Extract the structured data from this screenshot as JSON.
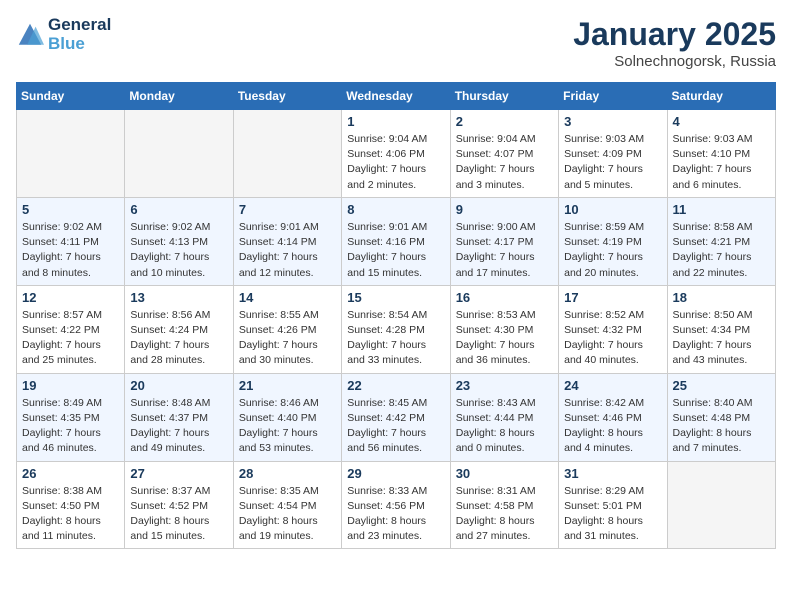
{
  "logo": {
    "line1": "General",
    "line2": "Blue"
  },
  "title": "January 2025",
  "subtitle": "Solnechnogorsk, Russia",
  "weekdays": [
    "Sunday",
    "Monday",
    "Tuesday",
    "Wednesday",
    "Thursday",
    "Friday",
    "Saturday"
  ],
  "weeks": [
    [
      {
        "day": "",
        "sunrise": "",
        "sunset": "",
        "daylight": ""
      },
      {
        "day": "",
        "sunrise": "",
        "sunset": "",
        "daylight": ""
      },
      {
        "day": "",
        "sunrise": "",
        "sunset": "",
        "daylight": ""
      },
      {
        "day": "1",
        "sunrise": "Sunrise: 9:04 AM",
        "sunset": "Sunset: 4:06 PM",
        "daylight": "Daylight: 7 hours and 2 minutes."
      },
      {
        "day": "2",
        "sunrise": "Sunrise: 9:04 AM",
        "sunset": "Sunset: 4:07 PM",
        "daylight": "Daylight: 7 hours and 3 minutes."
      },
      {
        "day": "3",
        "sunrise": "Sunrise: 9:03 AM",
        "sunset": "Sunset: 4:09 PM",
        "daylight": "Daylight: 7 hours and 5 minutes."
      },
      {
        "day": "4",
        "sunrise": "Sunrise: 9:03 AM",
        "sunset": "Sunset: 4:10 PM",
        "daylight": "Daylight: 7 hours and 6 minutes."
      }
    ],
    [
      {
        "day": "5",
        "sunrise": "Sunrise: 9:02 AM",
        "sunset": "Sunset: 4:11 PM",
        "daylight": "Daylight: 7 hours and 8 minutes."
      },
      {
        "day": "6",
        "sunrise": "Sunrise: 9:02 AM",
        "sunset": "Sunset: 4:13 PM",
        "daylight": "Daylight: 7 hours and 10 minutes."
      },
      {
        "day": "7",
        "sunrise": "Sunrise: 9:01 AM",
        "sunset": "Sunset: 4:14 PM",
        "daylight": "Daylight: 7 hours and 12 minutes."
      },
      {
        "day": "8",
        "sunrise": "Sunrise: 9:01 AM",
        "sunset": "Sunset: 4:16 PM",
        "daylight": "Daylight: 7 hours and 15 minutes."
      },
      {
        "day": "9",
        "sunrise": "Sunrise: 9:00 AM",
        "sunset": "Sunset: 4:17 PM",
        "daylight": "Daylight: 7 hours and 17 minutes."
      },
      {
        "day": "10",
        "sunrise": "Sunrise: 8:59 AM",
        "sunset": "Sunset: 4:19 PM",
        "daylight": "Daylight: 7 hours and 20 minutes."
      },
      {
        "day": "11",
        "sunrise": "Sunrise: 8:58 AM",
        "sunset": "Sunset: 4:21 PM",
        "daylight": "Daylight: 7 hours and 22 minutes."
      }
    ],
    [
      {
        "day": "12",
        "sunrise": "Sunrise: 8:57 AM",
        "sunset": "Sunset: 4:22 PM",
        "daylight": "Daylight: 7 hours and 25 minutes."
      },
      {
        "day": "13",
        "sunrise": "Sunrise: 8:56 AM",
        "sunset": "Sunset: 4:24 PM",
        "daylight": "Daylight: 7 hours and 28 minutes."
      },
      {
        "day": "14",
        "sunrise": "Sunrise: 8:55 AM",
        "sunset": "Sunset: 4:26 PM",
        "daylight": "Daylight: 7 hours and 30 minutes."
      },
      {
        "day": "15",
        "sunrise": "Sunrise: 8:54 AM",
        "sunset": "Sunset: 4:28 PM",
        "daylight": "Daylight: 7 hours and 33 minutes."
      },
      {
        "day": "16",
        "sunrise": "Sunrise: 8:53 AM",
        "sunset": "Sunset: 4:30 PM",
        "daylight": "Daylight: 7 hours and 36 minutes."
      },
      {
        "day": "17",
        "sunrise": "Sunrise: 8:52 AM",
        "sunset": "Sunset: 4:32 PM",
        "daylight": "Daylight: 7 hours and 40 minutes."
      },
      {
        "day": "18",
        "sunrise": "Sunrise: 8:50 AM",
        "sunset": "Sunset: 4:34 PM",
        "daylight": "Daylight: 7 hours and 43 minutes."
      }
    ],
    [
      {
        "day": "19",
        "sunrise": "Sunrise: 8:49 AM",
        "sunset": "Sunset: 4:35 PM",
        "daylight": "Daylight: 7 hours and 46 minutes."
      },
      {
        "day": "20",
        "sunrise": "Sunrise: 8:48 AM",
        "sunset": "Sunset: 4:37 PM",
        "daylight": "Daylight: 7 hours and 49 minutes."
      },
      {
        "day": "21",
        "sunrise": "Sunrise: 8:46 AM",
        "sunset": "Sunset: 4:40 PM",
        "daylight": "Daylight: 7 hours and 53 minutes."
      },
      {
        "day": "22",
        "sunrise": "Sunrise: 8:45 AM",
        "sunset": "Sunset: 4:42 PM",
        "daylight": "Daylight: 7 hours and 56 minutes."
      },
      {
        "day": "23",
        "sunrise": "Sunrise: 8:43 AM",
        "sunset": "Sunset: 4:44 PM",
        "daylight": "Daylight: 8 hours and 0 minutes."
      },
      {
        "day": "24",
        "sunrise": "Sunrise: 8:42 AM",
        "sunset": "Sunset: 4:46 PM",
        "daylight": "Daylight: 8 hours and 4 minutes."
      },
      {
        "day": "25",
        "sunrise": "Sunrise: 8:40 AM",
        "sunset": "Sunset: 4:48 PM",
        "daylight": "Daylight: 8 hours and 7 minutes."
      }
    ],
    [
      {
        "day": "26",
        "sunrise": "Sunrise: 8:38 AM",
        "sunset": "Sunset: 4:50 PM",
        "daylight": "Daylight: 8 hours and 11 minutes."
      },
      {
        "day": "27",
        "sunrise": "Sunrise: 8:37 AM",
        "sunset": "Sunset: 4:52 PM",
        "daylight": "Daylight: 8 hours and 15 minutes."
      },
      {
        "day": "28",
        "sunrise": "Sunrise: 8:35 AM",
        "sunset": "Sunset: 4:54 PM",
        "daylight": "Daylight: 8 hours and 19 minutes."
      },
      {
        "day": "29",
        "sunrise": "Sunrise: 8:33 AM",
        "sunset": "Sunset: 4:56 PM",
        "daylight": "Daylight: 8 hours and 23 minutes."
      },
      {
        "day": "30",
        "sunrise": "Sunrise: 8:31 AM",
        "sunset": "Sunset: 4:58 PM",
        "daylight": "Daylight: 8 hours and 27 minutes."
      },
      {
        "day": "31",
        "sunrise": "Sunrise: 8:29 AM",
        "sunset": "Sunset: 5:01 PM",
        "daylight": "Daylight: 8 hours and 31 minutes."
      },
      {
        "day": "",
        "sunrise": "",
        "sunset": "",
        "daylight": ""
      }
    ]
  ]
}
